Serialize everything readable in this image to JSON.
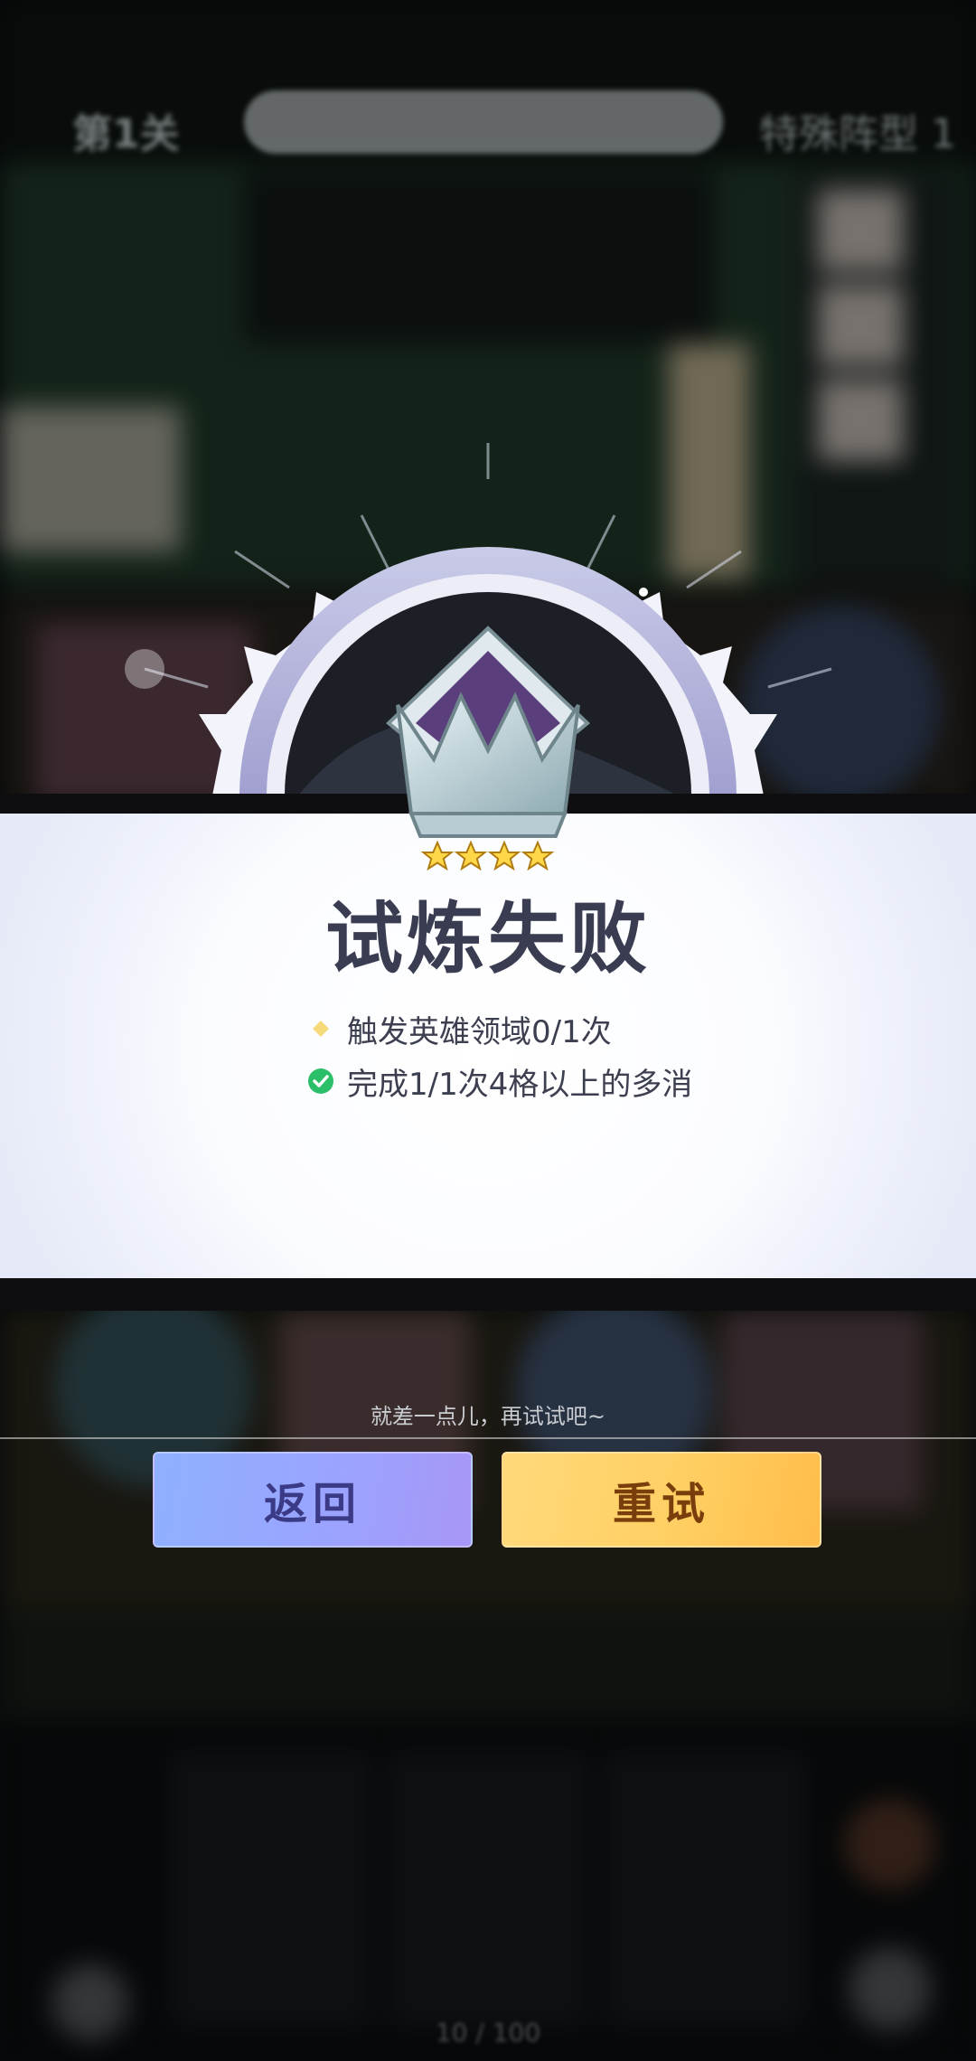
{
  "hud": {
    "level": "第1关",
    "right_label": "特殊阵型",
    "right_count": "1"
  },
  "result": {
    "status": "failed",
    "title": "试炼失败",
    "stars_total": 4,
    "objectives": [
      {
        "text": "触发英雄领域0/1次",
        "completed": false,
        "icon": "diamond-bullet-icon"
      },
      {
        "text": "完成1/1次4格以上的多消",
        "completed": true,
        "icon": "check-circle-icon"
      }
    ]
  },
  "hint": "就差一点儿，再试试吧~",
  "buttons": {
    "back_label": "返回",
    "retry_label": "重试"
  },
  "bottom_counter": "10 / 100",
  "colors": {
    "back_button": "#9aa4ff",
    "retry_button": "#ffcf63",
    "title": "#3a3d52",
    "check": "#2bbf6a"
  }
}
